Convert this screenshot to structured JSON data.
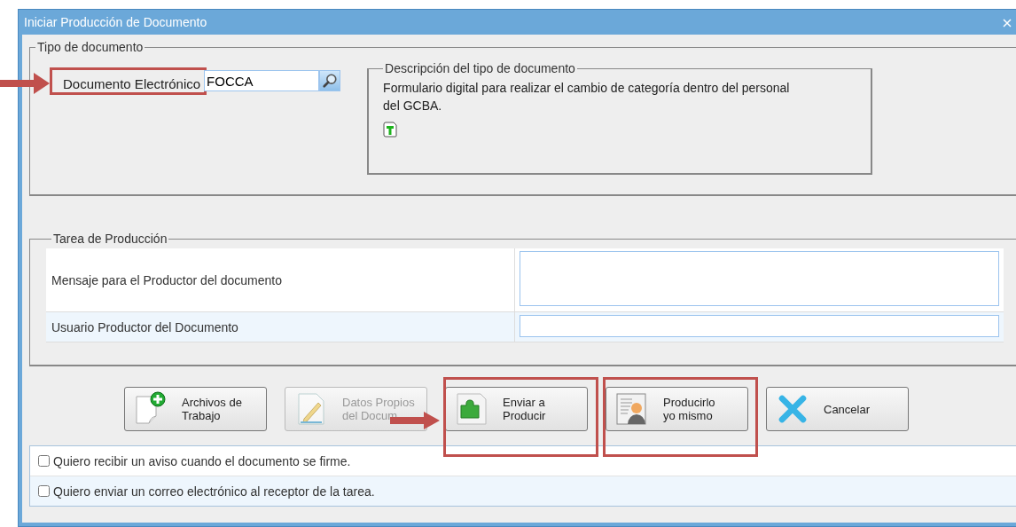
{
  "window": {
    "title": "Iniciar Producción de Documento"
  },
  "document_type": {
    "legend": "Tipo de documento",
    "label": "Documento Electrónico",
    "label_highlighted": true,
    "value": "FOCCA",
    "description": {
      "legend": "Descripción del tipo de documento",
      "text": "Formulario digital para realizar el cambio de categoría dentro del personal del GCBA."
    }
  },
  "production_task": {
    "legend": "Tarea de Producción",
    "rows": [
      {
        "label": "Mensaje para el Productor del documento",
        "kind": "textarea"
      },
      {
        "label": "Usuario Productor del Documento",
        "kind": "input"
      }
    ]
  },
  "buttons": [
    {
      "lines": [
        "Archivos de",
        "Trabajo"
      ],
      "kind": "add",
      "disabled": false,
      "highlighted": false
    },
    {
      "lines": [
        "Datos Propios",
        "del Docum"
      ],
      "kind": "edit",
      "disabled": true,
      "highlighted": false
    },
    {
      "lines": [
        "Enviar a",
        "Producir"
      ],
      "kind": "puzzle",
      "disabled": false,
      "highlighted": true
    },
    {
      "lines": [
        "Producirlo",
        "yo mismo"
      ],
      "kind": "person",
      "disabled": false,
      "highlighted": true
    },
    {
      "lines": [
        "Cancelar"
      ],
      "kind": "cancel",
      "disabled": false,
      "highlighted": false
    }
  ],
  "options": [
    {
      "label": "Quiero recibir un aviso cuando el documento se firme.",
      "checked": false
    },
    {
      "label": "Quiero enviar un correo electrónico al receptor de la tarea.",
      "checked": false
    }
  ]
}
